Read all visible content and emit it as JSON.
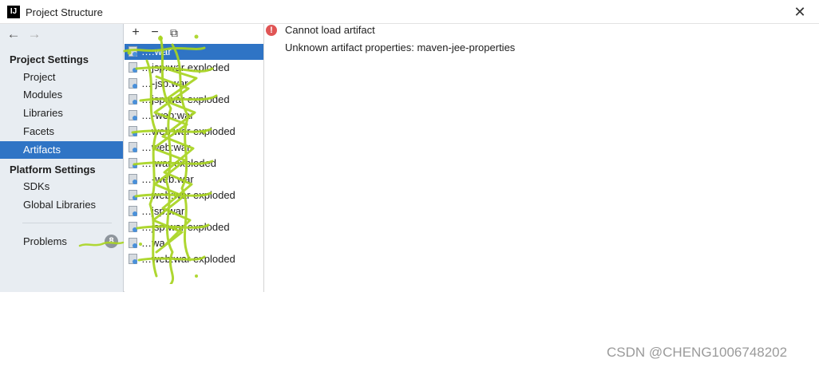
{
  "window": {
    "title": "Project Structure",
    "app_icon_text": "IJ",
    "close_icon": "close-icon"
  },
  "nav": {
    "back_icon": "arrow-left-icon",
    "forward_icon": "arrow-right-icon",
    "back_glyph": "←",
    "forward_glyph": "→"
  },
  "sidebar": {
    "project_settings_header": "Project Settings",
    "project_settings_items": [
      {
        "label": "Project"
      },
      {
        "label": "Modules"
      },
      {
        "label": "Libraries"
      },
      {
        "label": "Facets"
      },
      {
        "label": "Artifacts",
        "selected": true
      }
    ],
    "platform_settings_header": "Platform Settings",
    "platform_settings_items": [
      {
        "label": "SDKs"
      },
      {
        "label": "Global Libraries"
      }
    ],
    "problems": {
      "label": "Problems",
      "count": "8"
    }
  },
  "toolbar": {
    "add_glyph": "+",
    "remove_glyph": "−",
    "copy_glyph": "⧉"
  },
  "artifacts": [
    {
      "label": "…:war",
      "selected": true
    },
    {
      "label": "…jsp:war exploded"
    },
    {
      "label": "…-jsp:war"
    },
    {
      "label": "…jsp:war exploded"
    },
    {
      "label": "…-web:war"
    },
    {
      "label": "…web:war exploded"
    },
    {
      "label": "…web:war"
    },
    {
      "label": "…:war exploded"
    },
    {
      "label": "…-web:war"
    },
    {
      "label": "…web:war exploded"
    },
    {
      "label": "…jsp:war"
    },
    {
      "label": "…jsp:war exploded"
    },
    {
      "label": "…wa"
    },
    {
      "label": "…web:war exploded"
    }
  ],
  "content": {
    "error_title": "Cannot load artifact",
    "error_detail": "Unknown artifact properties: maven-jee-properties"
  },
  "watermark": "CSDN @CHENG1006748202",
  "colors": {
    "selection": "#2f74c5",
    "sidebar_bg": "#e8edf2",
    "error": "#e05555",
    "scribble": "#a8d420"
  }
}
